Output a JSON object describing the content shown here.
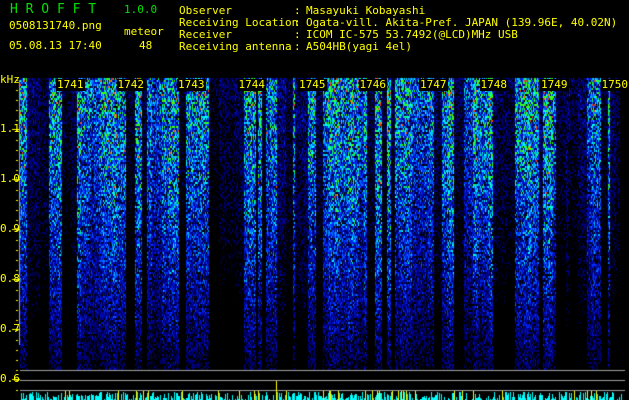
{
  "header": {
    "app_name": "H R O F F T",
    "version": "1.0.0",
    "filename": "0508131740.png",
    "datetime": "05.08.13 17:40",
    "meteor_label": "meteor",
    "meteor_count": "48"
  },
  "station": {
    "observer_label": "Observer",
    "observer": "Masayuki Kobayashi",
    "location_label": "Receiving Location",
    "location": "Ogata-vill. Akita-Pref. JAPAN (139.96E, 40.02N)",
    "receiver_label": "Receiver",
    "receiver": "ICOM IC-575 53.7492(@LCD)MHz USB",
    "antenna_label": "Receiving antenna",
    "antenna": "A504HB(yagi 4el)",
    "separator": ":"
  },
  "spectrogram": {
    "y_unit": "kHz",
    "y_ticks": [
      "1.1",
      "1.0",
      "0.9",
      "0.8",
      "0.7",
      "0.6"
    ],
    "minute_labels": [
      "1741",
      "1742",
      "1743",
      "1744",
      "1745",
      "1746",
      "1747",
      "1748",
      "1749",
      "1750"
    ],
    "colors": {
      "text": "#ffff00",
      "title": "#00e000",
      "histogram": "#00ffff",
      "detect": "#ffff00",
      "guide": "#a0a0a0"
    }
  }
}
